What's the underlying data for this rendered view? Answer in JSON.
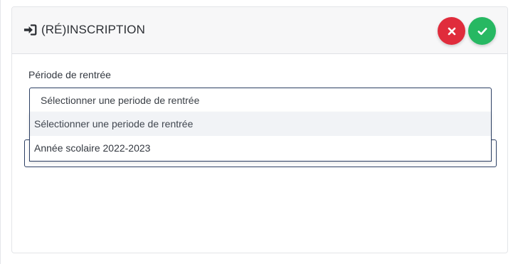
{
  "panel": {
    "title": "(RÉ)INSCRIPTION",
    "title_icon": "sign-in-icon",
    "actions": {
      "cancel_icon": "close-icon",
      "confirm_icon": "check-icon"
    }
  },
  "form": {
    "period_label": "Période de rentrée",
    "period_select": {
      "selected": "Sélectionner une periode de rentrée",
      "options": [
        "Sélectionner une periode de rentrée",
        "Année scolaire 2022-2023"
      ],
      "highlighted_index": 0
    }
  },
  "colors": {
    "cancel": "#e02c3c",
    "confirm": "#27b862",
    "select_border": "#2c3f63",
    "header_bg": "#f7f7f8"
  }
}
